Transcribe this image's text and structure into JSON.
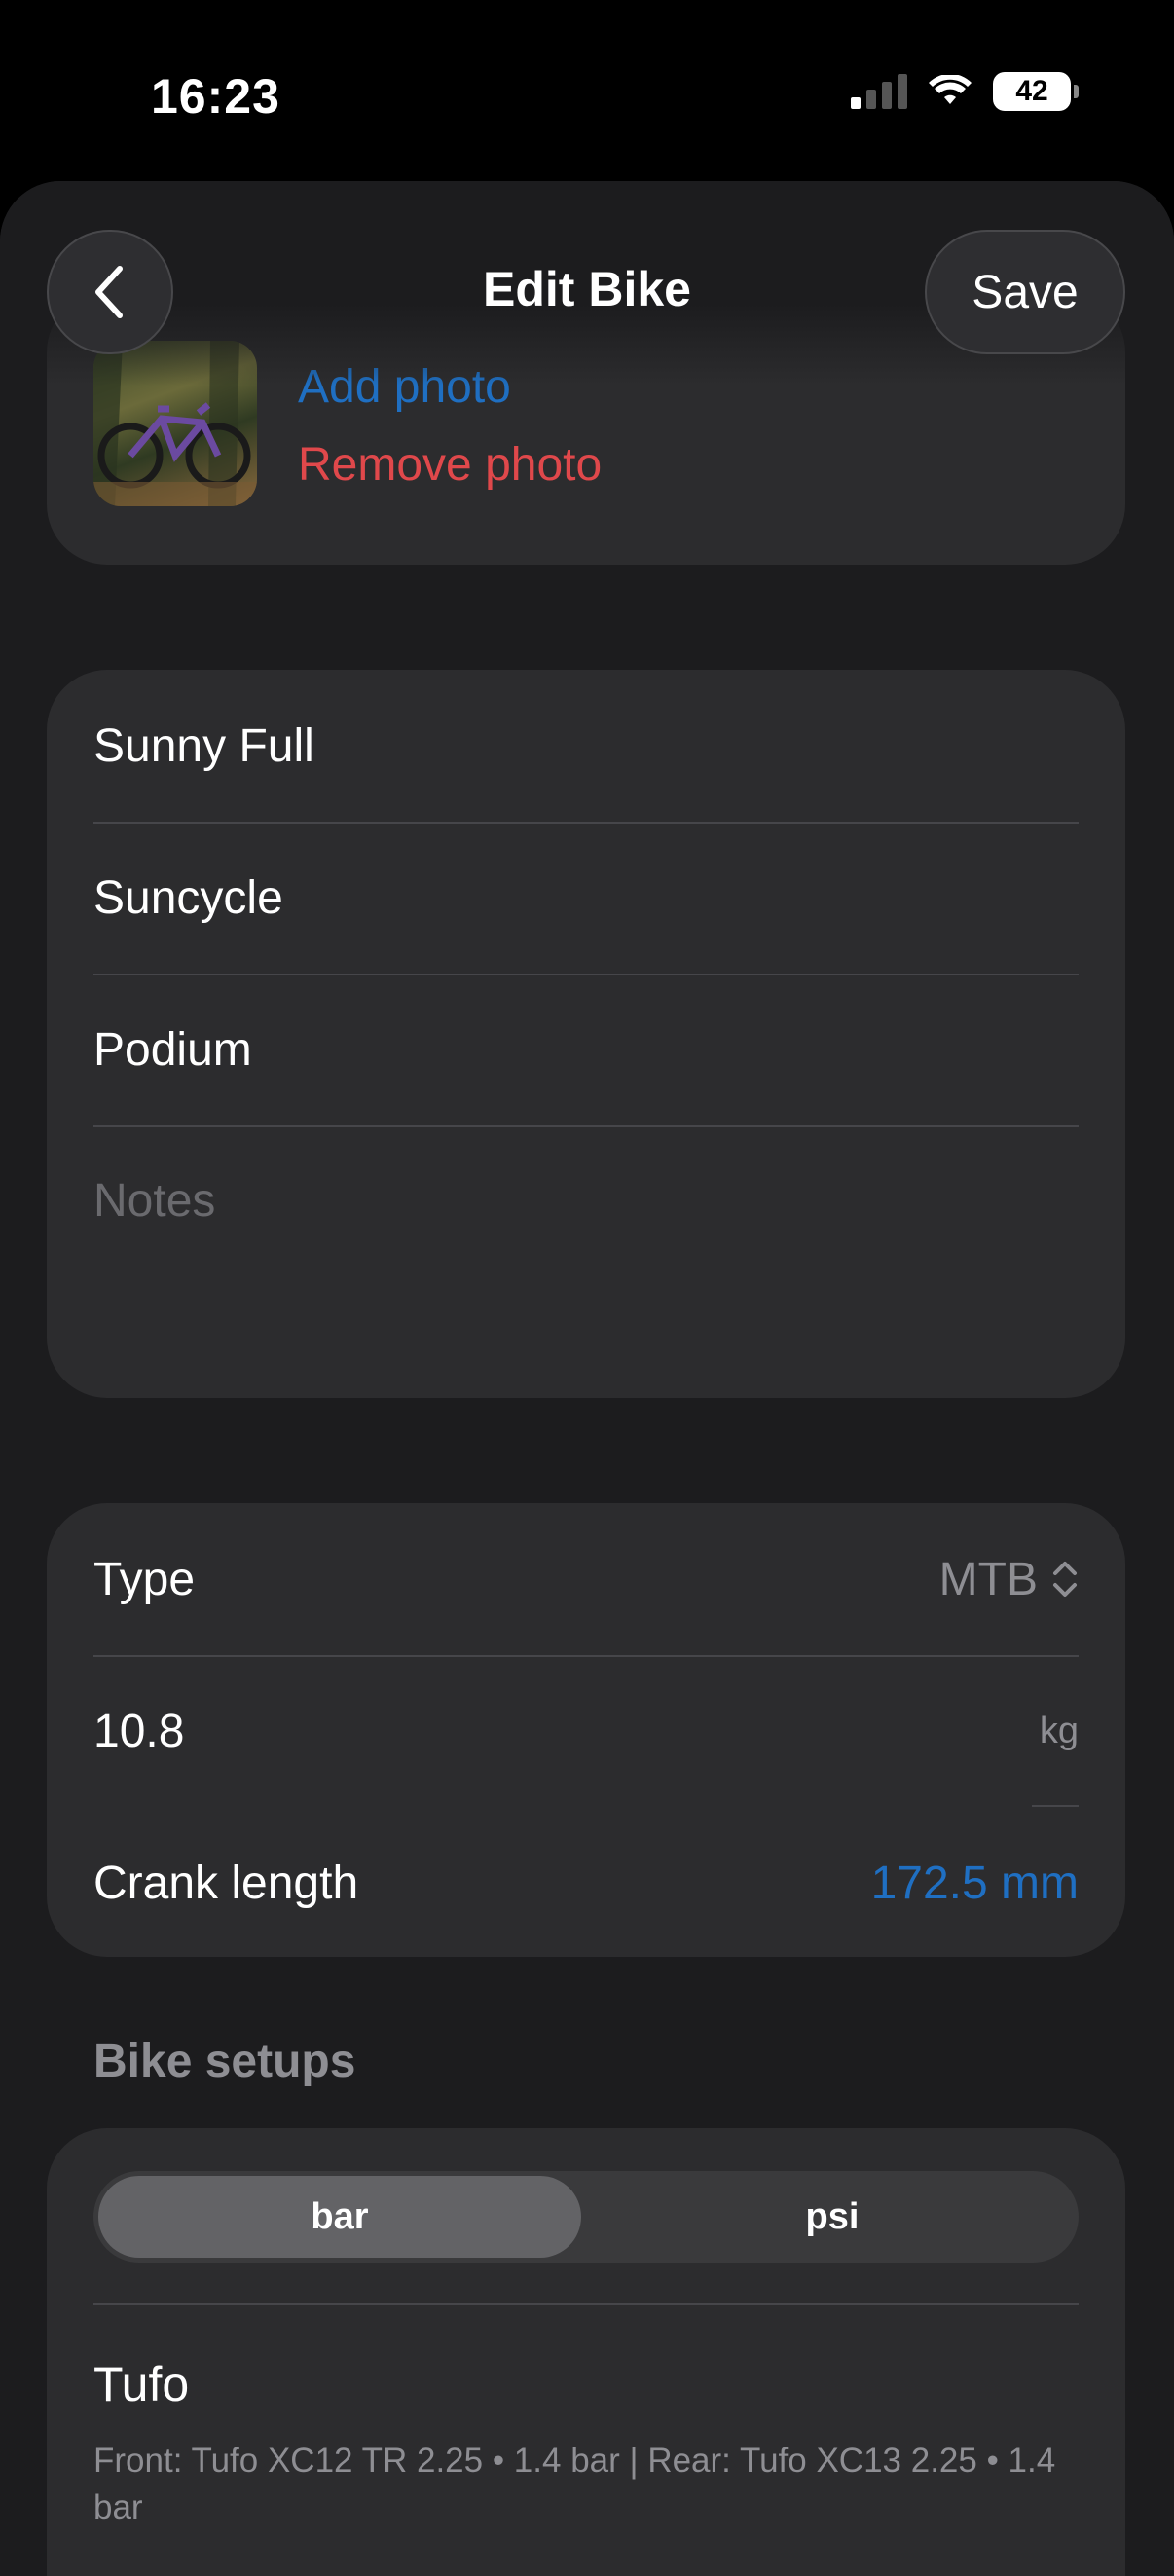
{
  "status": {
    "time": "16:23",
    "battery": "42"
  },
  "nav": {
    "title": "Edit Bike",
    "save_label": "Save"
  },
  "photo": {
    "add_label": "Add photo",
    "remove_label": "Remove photo"
  },
  "details": {
    "name": "Sunny Full",
    "brand": "Suncycle",
    "model": "Podium",
    "notes_placeholder": "Notes"
  },
  "specs": {
    "type_label": "Type",
    "type_value": "MTB",
    "weight_value": "10.8",
    "weight_unit": "kg",
    "crank_label": "Crank length",
    "crank_value": "172.5 mm"
  },
  "setups": {
    "header": "Bike setups",
    "units": [
      "bar",
      "psi"
    ],
    "selected_unit": "bar",
    "items": [
      {
        "name": "Tufo",
        "detail": "Front: Tufo XC12 TR 2.25 • 1.4 bar  |  Rear: Tufo XC13 2.25 • 1.4 bar"
      }
    ]
  },
  "colors": {
    "accent": "#1f6fc2",
    "destructive": "#e0484b",
    "card": "#2c2c2e",
    "background": "#1c1c1e"
  }
}
